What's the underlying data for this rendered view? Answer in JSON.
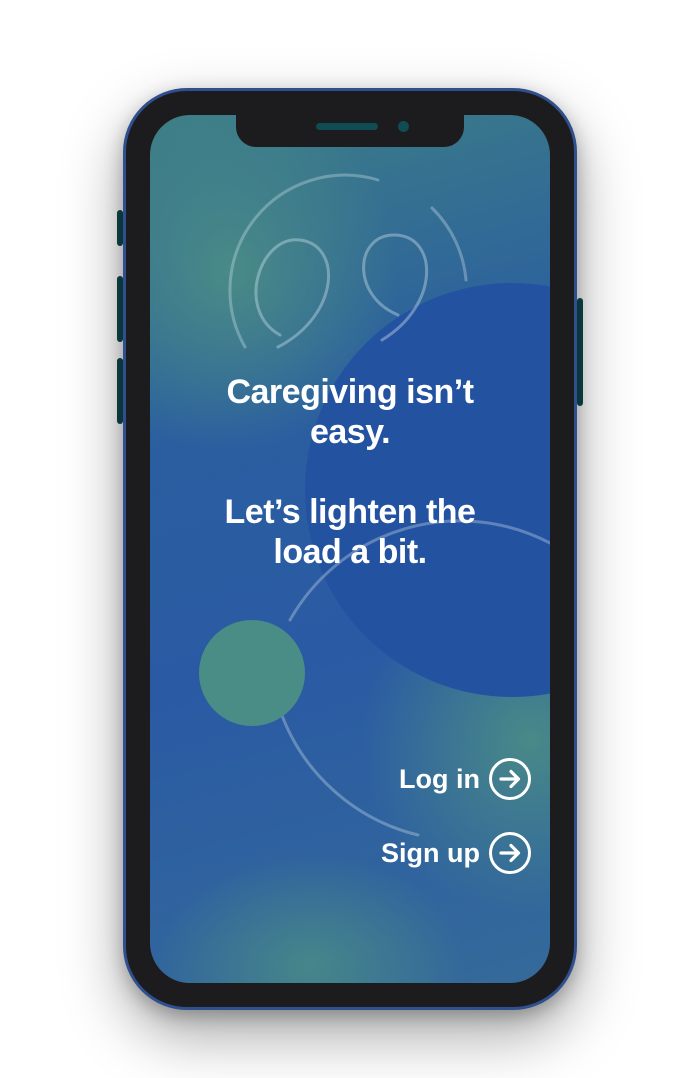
{
  "headline": {
    "line1": "Caregiving isn’t",
    "line2": "easy.",
    "line3": "Let’s lighten the",
    "line4": "load a bit."
  },
  "actions": {
    "login_label": "Log in",
    "signup_label": "Sign up"
  },
  "colors": {
    "teal": "#4a8c86",
    "blue": "#2a5aa4",
    "deep_blue": "#2352a0",
    "text": "#ffffff",
    "frame": "#1c1c1e",
    "frame_border": "#2f4f8f"
  },
  "icons": {
    "login": "arrow-right-circle-icon",
    "signup": "arrow-right-circle-icon"
  }
}
